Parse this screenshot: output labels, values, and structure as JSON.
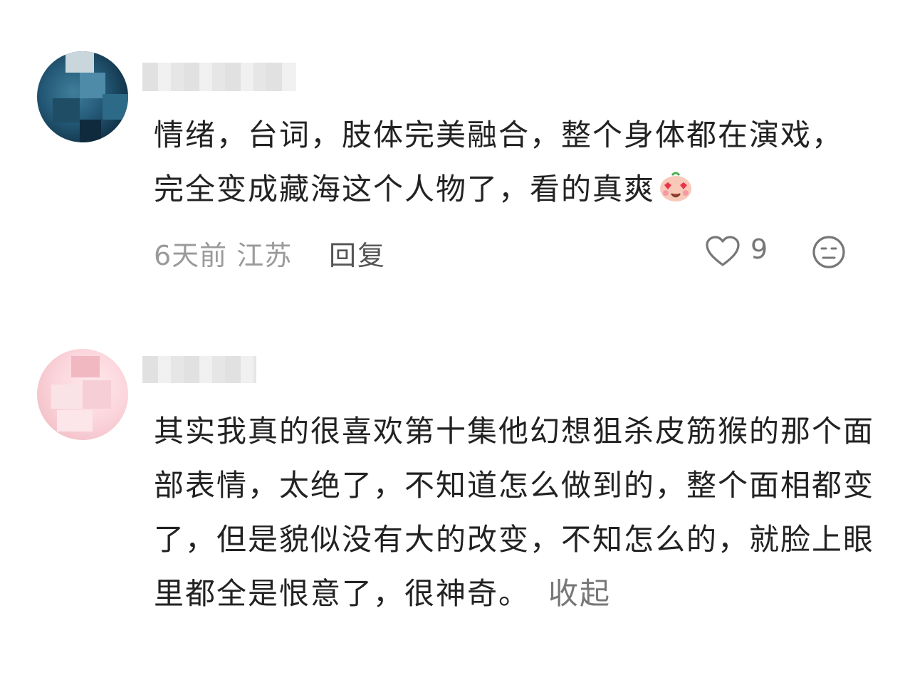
{
  "comments": [
    {
      "avatar_icon": "user-avatar-blurred",
      "username_blurred": true,
      "text": "情绪，台词，肢体完美融合，整个身体都在演戏，完全变成藏海这个人物了，看的真爽",
      "emoji_icon": "heart-eyes-emoji",
      "time": "6天前",
      "location": "江苏",
      "meta": "6天前 江苏",
      "reply_label": "回复",
      "like_icon": "heart-outline-icon",
      "likes": "9",
      "dislike_icon": "meh-face-icon"
    },
    {
      "avatar_icon": "user-avatar-blurred",
      "username_blurred": true,
      "text": "其实我真的很喜欢第十集他幻想狙杀皮筋猴的那个面部表情，太绝了，不知道怎么做到的，整个面相都变了，但是貌似没有大的改变，不知怎么的，就脸上眼里都全是恨意了，很神奇。",
      "collapse_label": "收起"
    }
  ],
  "colors": {
    "text": "#222222",
    "meta": "#9a9a9a",
    "reply": "#555555",
    "icon": "#777777"
  }
}
